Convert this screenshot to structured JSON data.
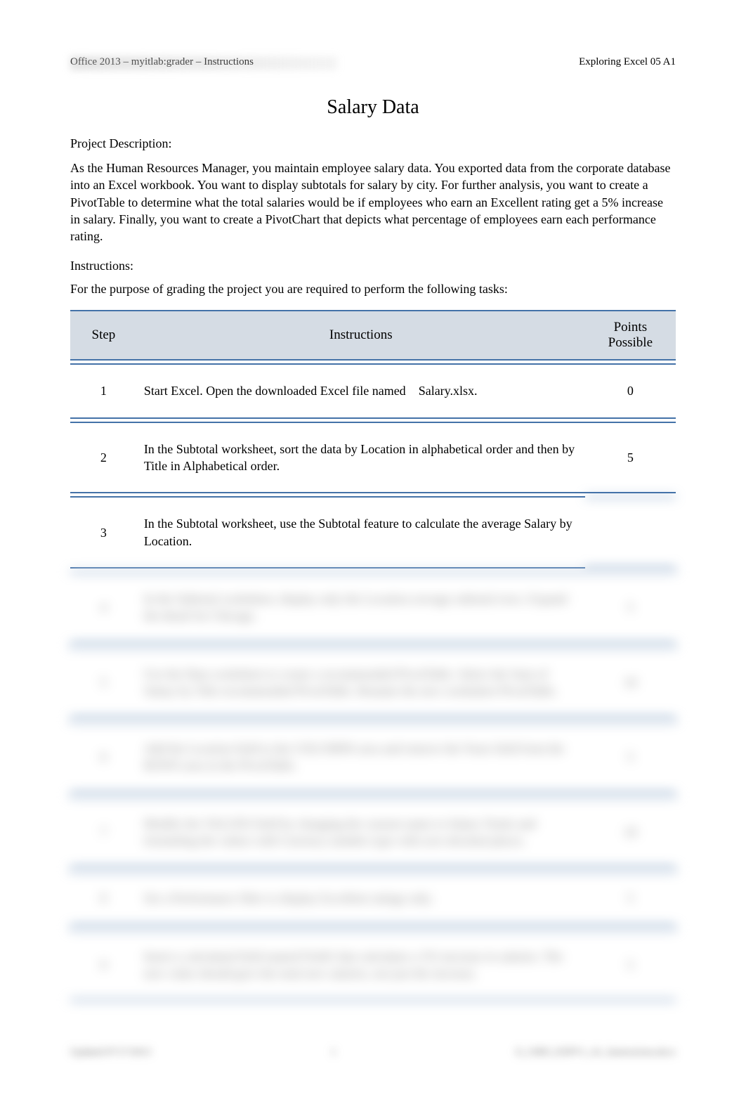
{
  "header": {
    "left": "Office 2013 – myitlab:grader – Instructions",
    "right": "Exploring Excel 05 A1"
  },
  "title": "Salary Data",
  "project_description_label": "Project Description:",
  "project_description": "As the Human Resources Manager, you maintain employee salary data. You exported data from the corporate database into an Excel workbook. You want to display subtotals for salary by city. For further analysis, you want to create a PivotTable to determine what the total salaries would be if employees who earn an Excellent rating get a 5% increase in salary. Finally, you want to create a PivotChart that depicts what percentage of employees earn each performance rating.",
  "instructions_label": "Instructions:",
  "instructions_lead": "For the purpose of grading the project you are required to perform the following tasks:",
  "table": {
    "headers": {
      "step": "Step",
      "instructions": "Instructions",
      "points": "Points Possible"
    },
    "rows": [
      {
        "step": "1",
        "instructions_prefix": "Start Excel. Open the downloaded Excel file named",
        "instructions_suffix": "Salary.xlsx.",
        "points": "0"
      },
      {
        "step": "2",
        "instructions": "In the Subtotal worksheet, sort the data by Location in alphabetical order and then by Title in Alphabetical order.",
        "points": "5"
      },
      {
        "step": "3",
        "instructions": "In the Subtotal worksheet, use the Subtotal feature to calculate the average Salary by Location.",
        "points": ""
      }
    ],
    "blurred_rows": [
      {
        "step": "4",
        "instructions": "In the Subtotal worksheet, display only the Location average subtotal rows. Expand the detail for Chicago.",
        "points": "5"
      },
      {
        "step": "5",
        "instructions": "Use the Data worksheet to create a recommended PivotTable. Select the Sum of Salary by Title recommended PivotTable. Rename the new worksheet PivotTable.",
        "points": "10"
      },
      {
        "step": "6",
        "instructions": "Add the Location field to the COLUMNS area and remove the Years field from the ROWS area in the PivotTable.",
        "points": "5"
      },
      {
        "step": "7",
        "instructions": "Modify the VALUES field by changing the custom name to Salary Totals and formatting the values with Currency number type with zero decimal places.",
        "points": "10"
      },
      {
        "step": "8",
        "instructions": "Set a Performance filter to display Excellent ratings only.",
        "points": "5"
      },
      {
        "step": "9",
        "instructions": "Insert a calculated field named Field1 that calculates a 5% increase in salaries. The new value should give the total new salaries, not just the increase.",
        "points": "5"
      }
    ]
  },
  "footer": {
    "left": "Updated 07/17/2013",
    "center": "1",
    "right": "E_CH05_EXPV1_A1_Instructions.docx"
  }
}
